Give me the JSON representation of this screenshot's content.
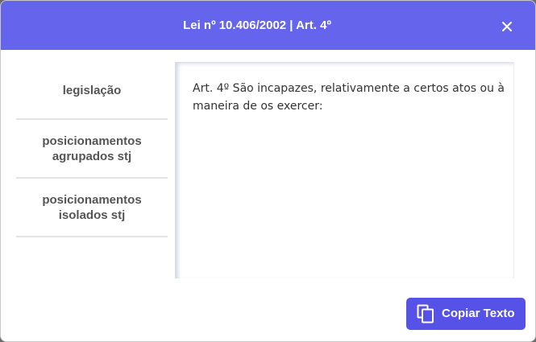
{
  "dialog": {
    "title": "Lei nº 10.406/2002 | Art. 4º",
    "close_icon": "close-icon"
  },
  "sidebar": {
    "items": [
      {
        "label": "legislação"
      },
      {
        "label": "posicionamentos agrupados stj"
      },
      {
        "label": "posicionamentos isolados stj"
      }
    ]
  },
  "content": {
    "text": "Art. 4º São incapazes, relativamente a certos atos ou à maneira de os exercer:"
  },
  "footer": {
    "copy_label": "Copiar Texto",
    "copy_icon": "copy-icon"
  },
  "colors": {
    "header": "#6464ec",
    "button": "#5652e8",
    "nav_text": "#555555"
  }
}
